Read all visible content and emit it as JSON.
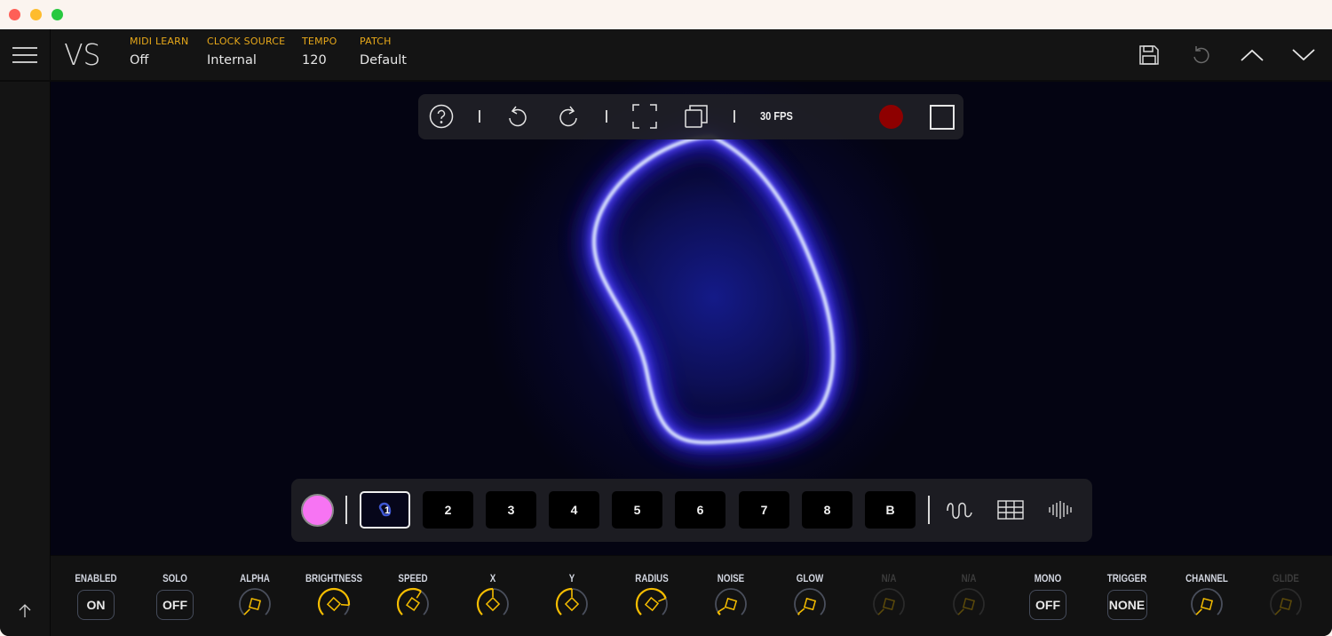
{
  "window": {
    "controls": [
      "close",
      "minimize",
      "maximize"
    ]
  },
  "header": {
    "logo": "VS",
    "fields": [
      {
        "label": "MIDI LEARN",
        "value": "Off"
      },
      {
        "label": "CLOCK SOURCE",
        "value": "Internal"
      },
      {
        "label": "TEMPO",
        "value": "120"
      },
      {
        "label": "PATCH",
        "value": "Default"
      }
    ],
    "actions": [
      "save-icon",
      "undo-icon",
      "chevron-up-icon",
      "chevron-down-icon"
    ]
  },
  "toolbar": {
    "items": [
      "help-icon",
      "undo-icon",
      "redo-icon",
      "fullscreen-icon",
      "duplicate-icon"
    ],
    "fps": "30 FPS",
    "record_color": "#8e0000"
  },
  "slots": {
    "color_swatch": "#f774f3",
    "active_slot": "1",
    "items": [
      "1",
      "2",
      "3",
      "4",
      "5",
      "6",
      "7",
      "8",
      "B"
    ],
    "views": [
      "waveform-icon",
      "grid-icon",
      "spectrum-icon"
    ]
  },
  "controls": [
    {
      "label": "ENABLED",
      "type": "button",
      "value": "ON"
    },
    {
      "label": "SOLO",
      "type": "button",
      "value": "OFF"
    },
    {
      "label": "ALPHA",
      "type": "knob",
      "value": 0.0
    },
    {
      "label": "BRIGHTNESS",
      "type": "knob",
      "value": 0.85
    },
    {
      "label": "SPEED",
      "type": "knob",
      "value": 0.62
    },
    {
      "label": "X",
      "type": "knob",
      "value": 0.5
    },
    {
      "label": "Y",
      "type": "knob",
      "value": 0.5
    },
    {
      "label": "RADIUS",
      "type": "knob",
      "value": 0.75
    },
    {
      "label": "NOISE",
      "type": "knob",
      "value": 0.05
    },
    {
      "label": "GLOW",
      "type": "knob",
      "value": 0.02
    },
    {
      "label": "N/A",
      "type": "knob",
      "value": 0.0,
      "disabled": true
    },
    {
      "label": "N/A",
      "type": "knob",
      "value": 0.0,
      "disabled": true
    },
    {
      "label": "MONO",
      "type": "button",
      "value": "OFF"
    },
    {
      "label": "TRIGGER",
      "type": "button",
      "value": "NONE"
    },
    {
      "label": "CHANNEL",
      "type": "knob",
      "value": 0.0
    },
    {
      "label": "GLIDE",
      "type": "knob",
      "value": 0.0,
      "disabled": true
    }
  ],
  "accent_color": "#f5bd00",
  "glow_color": "#3a2cff"
}
